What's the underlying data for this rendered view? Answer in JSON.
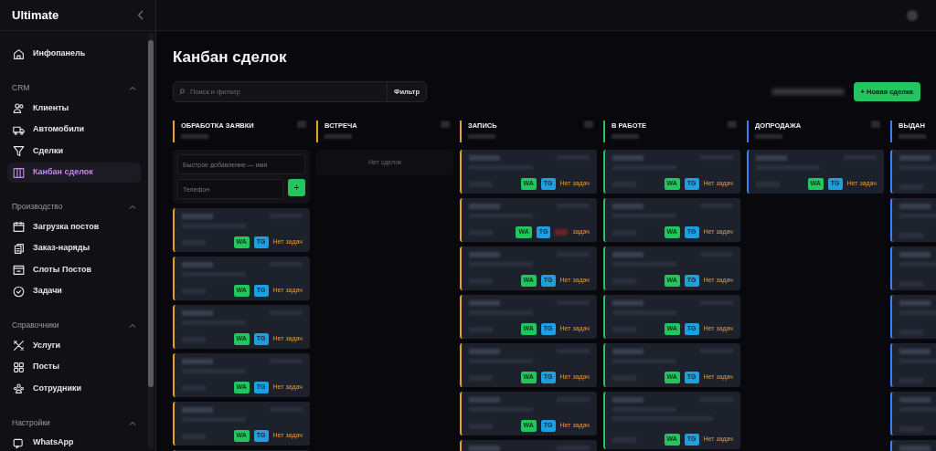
{
  "sidebar": {
    "logo": "Ultimate",
    "items": [
      {
        "label": "Инфопанель",
        "selected": false
      }
    ],
    "sections": [
      {
        "title": "CRM",
        "expanded": true,
        "items": [
          {
            "label": "Клиенты",
            "selected": false
          },
          {
            "label": "Автомобили",
            "selected": false
          },
          {
            "label": "Сделки",
            "selected": false
          },
          {
            "label": "Канбан сделок",
            "selected": true
          }
        ]
      },
      {
        "title": "Производство",
        "expanded": true,
        "items": [
          {
            "label": "Загрузка постов",
            "selected": false
          },
          {
            "label": "Заказ-наряды",
            "selected": false
          },
          {
            "label": "Слоты Постов",
            "selected": false
          },
          {
            "label": "Задачи",
            "selected": false
          }
        ]
      },
      {
        "title": "Справочники",
        "expanded": true,
        "items": [
          {
            "label": "Услуги",
            "selected": false
          },
          {
            "label": "Посты",
            "selected": false
          },
          {
            "label": "Сотрудники",
            "selected": false
          }
        ]
      },
      {
        "title": "Настройки",
        "expanded": true,
        "items": [
          {
            "label": "WhatsApp",
            "selected": false
          }
        ]
      }
    ]
  },
  "page": {
    "title": "Канбан сделок",
    "search": {
      "placeholder": "Поиск и фильтр"
    },
    "filter_button": "Фильтр",
    "new_button": "+ Новая сделка"
  },
  "columns": [
    {
      "title": "ОБРАБОТКА ЗАЯВКИ",
      "color": "#e0a526",
      "quick_add": {
        "name_placeholder": "Быстрое добавление — имя",
        "phone_placeholder": "Телефон",
        "add_button": "+"
      },
      "cards": [
        {
          "kind": "deal",
          "tags": [
            "WA",
            "TG"
          ],
          "tasks": "Нет задач"
        },
        {
          "kind": "deal",
          "tags": [
            "WA",
            "TG"
          ],
          "tasks": "Нет задач"
        },
        {
          "kind": "deal",
          "tags": [
            "WA",
            "TG"
          ],
          "tasks": "Нет задач"
        },
        {
          "kind": "deal",
          "tags": [
            "WA",
            "TG"
          ],
          "tasks": "Нет задач"
        },
        {
          "kind": "deal",
          "tags": [
            "WA",
            "TG"
          ],
          "tasks": "Нет задач"
        },
        {
          "kind": "hidden"
        }
      ]
    },
    {
      "title": "ВСТРЕЧА",
      "color": "#e0a526",
      "empty_text": "Нет сделок"
    },
    {
      "title": "ЗАПИСЬ",
      "color": "#e0a526",
      "cards": [
        {
          "kind": "deal",
          "tags": [
            "WA",
            "TG"
          ],
          "tasks": "Нет задач"
        },
        {
          "kind": "deal",
          "tags": [
            "WA",
            "TG"
          ],
          "tasks": "задач",
          "overdue": true
        },
        {
          "kind": "deal",
          "tags": [
            "WA",
            "TG"
          ],
          "tasks": "Нет задач"
        },
        {
          "kind": "deal",
          "tags": [
            "WA",
            "TG"
          ],
          "tasks": "Нет задач"
        },
        {
          "kind": "deal",
          "tags": [
            "WA",
            "TG"
          ],
          "tasks": "Нет задач"
        },
        {
          "kind": "deal",
          "tags": [
            "WA",
            "TG"
          ],
          "tasks": "Нет задач"
        },
        {
          "kind": "hidden"
        }
      ]
    },
    {
      "title": "В РАБОТЕ",
      "color": "#22c55e",
      "cards": [
        {
          "kind": "deal",
          "tags": [
            "WA",
            "TG"
          ],
          "tasks": "Нет задач"
        },
        {
          "kind": "deal",
          "tags": [
            "WA",
            "TG"
          ],
          "tasks": "Нет задач"
        },
        {
          "kind": "deal",
          "tags": [
            "WA",
            "TG"
          ],
          "tasks": "Нет задач"
        },
        {
          "kind": "deal",
          "tags": [
            "WA",
            "TG"
          ],
          "tasks": "Нет задач"
        },
        {
          "kind": "deal",
          "tags": [
            "WA",
            "TG"
          ],
          "tasks": "Нет задач"
        },
        {
          "kind": "deal",
          "tags": [
            "WA",
            "TG"
          ],
          "tasks": "Нет задач",
          "tall": true
        }
      ]
    },
    {
      "title": "ДОПРОДАЖА",
      "color": "#3b82f6",
      "cards": [
        {
          "kind": "deal",
          "tags": [
            "WA",
            "TG"
          ],
          "tasks": "Нет задач"
        }
      ]
    },
    {
      "title": "ВЫДАН",
      "color": "#3b82f6",
      "cards": [
        {
          "kind": "hidden"
        },
        {
          "kind": "hidden"
        },
        {
          "kind": "hidden"
        },
        {
          "kind": "hidden"
        },
        {
          "kind": "hidden"
        },
        {
          "kind": "hidden"
        },
        {
          "kind": "hidden"
        }
      ]
    }
  ]
}
